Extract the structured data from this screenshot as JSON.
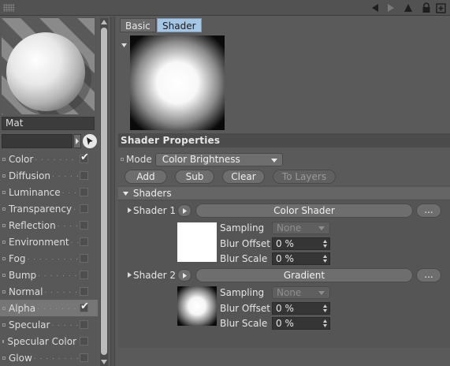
{
  "toolbar": {
    "icons": [
      "grip-icon",
      "back-arrow-icon",
      "forward-arrow-icon",
      "up-arrow-icon",
      "lock-icon",
      "new-window-icon"
    ]
  },
  "material": {
    "name": "Mat",
    "field_value": ""
  },
  "channels": [
    {
      "label": "Color",
      "checked": true,
      "selected": false
    },
    {
      "label": "Diffusion",
      "checked": false,
      "selected": false
    },
    {
      "label": "Luminance",
      "checked": false,
      "selected": false
    },
    {
      "label": "Transparency",
      "checked": false,
      "selected": false
    },
    {
      "label": "Reflection",
      "checked": false,
      "selected": false
    },
    {
      "label": "Environment",
      "checked": false,
      "selected": false
    },
    {
      "label": "Fog",
      "checked": false,
      "selected": false
    },
    {
      "label": "Bump",
      "checked": false,
      "selected": false
    },
    {
      "label": "Normal",
      "checked": false,
      "selected": false
    },
    {
      "label": "Alpha",
      "checked": true,
      "selected": true
    },
    {
      "label": "Specular",
      "checked": false,
      "selected": false
    },
    {
      "label": "Specular Color",
      "checked": false,
      "selected": false
    },
    {
      "label": "Glow",
      "checked": false,
      "selected": false
    }
  ],
  "tabs": [
    {
      "label": "Basic",
      "active": false
    },
    {
      "label": "Shader",
      "active": true
    }
  ],
  "properties": {
    "header": "Shader Properties",
    "mode_label": "Mode",
    "mode_value": "Color Brightness",
    "buttons": {
      "add": "Add",
      "sub": "Sub",
      "clear": "Clear",
      "to_layers": "To Layers"
    }
  },
  "shaders_section": {
    "header": "Shaders",
    "more_label": "...",
    "items": [
      {
        "name": "Shader 1",
        "shader": "Color Shader",
        "sampling_label": "Sampling",
        "sampling_value": "None",
        "blur_offset_label": "Blur Offset",
        "blur_offset_value": "0 %",
        "blur_scale_label": "Blur Scale",
        "blur_scale_value": "0 %"
      },
      {
        "name": "Shader 2",
        "shader": "Gradient",
        "sampling_label": "Sampling",
        "sampling_value": "None",
        "blur_offset_label": "Blur Offset",
        "blur_offset_value": "0 %",
        "blur_scale_label": "Blur Scale",
        "blur_scale_value": "0 %"
      }
    ]
  },
  "colors": {
    "tab_active": "#a6c6e6",
    "panel_bg": "#5a5a5a",
    "header_bg": "#4b4b4b"
  }
}
